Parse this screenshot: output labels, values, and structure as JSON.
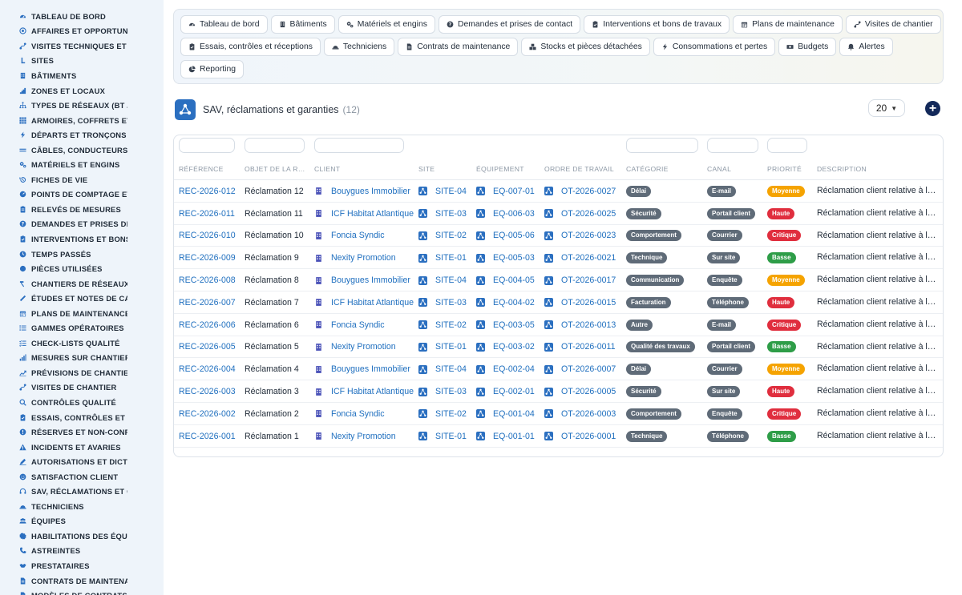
{
  "sidebar": {
    "items": [
      {
        "label": "TABLEAU DE BORD",
        "icon": "dashboard-icon"
      },
      {
        "label": "AFFAIRES ET OPPORTUNITÉS",
        "icon": "target-icon"
      },
      {
        "label": "VISITES TECHNIQUES ET DIAGNOSTICS",
        "icon": "route-icon"
      },
      {
        "label": "SITES",
        "icon": "pin-icon"
      },
      {
        "label": "BÂTIMENTS",
        "icon": "building-icon"
      },
      {
        "label": "ZONES ET LOCAUX",
        "icon": "stairs-icon"
      },
      {
        "label": "TYPES DE RÉSEAUX (BT / HTA)",
        "icon": "network-icon"
      },
      {
        "label": "ARMOIRES, COFFRETS ET TABLEAUX",
        "icon": "grid-icon"
      },
      {
        "label": "DÉPARTS ET TRONÇONS",
        "icon": "bolt-icon"
      },
      {
        "label": "CÂBLES, CONDUCTEURS",
        "icon": "lines-icon"
      },
      {
        "label": "MATÉRIELS ET ENGINS",
        "icon": "cogs-icon"
      },
      {
        "label": "FICHES DE VIE",
        "icon": "history-icon"
      },
      {
        "label": "POINTS DE COMPTAGE ET MESURE",
        "icon": "gauge-icon"
      },
      {
        "label": "RELEVÉS DE MESURES",
        "icon": "clipboard-icon"
      },
      {
        "label": "DEMANDES ET PRISES DE CONTACT",
        "icon": "help-icon"
      },
      {
        "label": "INTERVENTIONS ET BONS DE TRAVAUX",
        "icon": "clipboard-check-icon"
      },
      {
        "label": "TEMPS PASSÉS",
        "icon": "clock-icon"
      },
      {
        "label": "PIÈCES UTILISÉES",
        "icon": "dot-icon"
      },
      {
        "label": "CHANTIERS DE RÉSEAUX",
        "icon": "hammer-icon"
      },
      {
        "label": "ÉTUDES ET NOTES DE CALCUL",
        "icon": "ruler-icon"
      },
      {
        "label": "PLANS DE MAINTENANCE",
        "icon": "calendar-icon"
      },
      {
        "label": "GAMMES OPÉRATOIRES",
        "icon": "list-icon"
      },
      {
        "label": "CHECK-LISTS QUALITÉ",
        "icon": "checklist-icon"
      },
      {
        "label": "MESURES SUR CHANTIER",
        "icon": "signal-icon"
      },
      {
        "label": "PRÉVISIONS DE CHANTIER",
        "icon": "trend-icon"
      },
      {
        "label": "VISITES DE CHANTIER",
        "icon": "route-icon"
      },
      {
        "label": "CONTRÔLES QUALITÉ",
        "icon": "search-icon"
      },
      {
        "label": "ESSAIS, CONTRÔLES ET RÉCEPTIONS",
        "icon": "clipboard-check-icon"
      },
      {
        "label": "RÉSERVES ET NON-CONFORMITÉS",
        "icon": "alert-icon"
      },
      {
        "label": "INCIDENTS ET AVARIES",
        "icon": "warning-icon"
      },
      {
        "label": "AUTORISATIONS ET DICT",
        "icon": "sign-icon"
      },
      {
        "label": "SATISFACTION CLIENT",
        "icon": "smile-icon"
      },
      {
        "label": "SAV, RÉCLAMATIONS ET GARANTIES",
        "icon": "headset-icon"
      },
      {
        "label": "TECHNICIENS",
        "icon": "helmet-icon"
      },
      {
        "label": "ÉQUIPES",
        "icon": "users-icon"
      },
      {
        "label": "HABILITATIONS DES ÉQUIPES",
        "icon": "badge-icon"
      },
      {
        "label": "ASTREINTES",
        "icon": "phone-icon"
      },
      {
        "label": "PRESTATAIRES",
        "icon": "handshake-icon"
      },
      {
        "label": "CONTRATS DE MAINTENANCE",
        "icon": "file-icon"
      },
      {
        "label": "MODÈLES DE CONTRATS",
        "icon": "file-icon"
      }
    ]
  },
  "nav": {
    "rows": [
      [
        {
          "label": "Tableau de bord",
          "icon": "dashboard-icon"
        },
        {
          "label": "Bâtiments",
          "icon": "building-icon"
        },
        {
          "label": "Matériels et engins",
          "icon": "cogs-icon"
        },
        {
          "label": "Demandes et prises de contact",
          "icon": "help-icon"
        },
        {
          "label": "Interventions et bons de travaux",
          "icon": "clipboard-check-icon"
        },
        {
          "label": "Plans de maintenance",
          "icon": "calendar-icon"
        },
        {
          "label": "Visites de chantier",
          "icon": "route-icon"
        }
      ],
      [
        {
          "label": "Essais, contrôles et réceptions",
          "icon": "clipboard-check-icon"
        },
        {
          "label": "Techniciens",
          "icon": "helmet-icon"
        },
        {
          "label": "Contrats de maintenance",
          "icon": "file-icon"
        },
        {
          "label": "Stocks et pièces détachées",
          "icon": "boxes-icon"
        },
        {
          "label": "Consommations et pertes",
          "icon": "bolt-icon"
        },
        {
          "label": "Budgets",
          "icon": "money-icon"
        },
        {
          "label": "Alertes",
          "icon": "bell-icon"
        }
      ],
      [
        {
          "label": "Reporting",
          "icon": "chart-pie-icon"
        }
      ]
    ]
  },
  "header": {
    "title": "SAV, réclamations et garanties",
    "count": "(12)",
    "per_page": "20",
    "add_icon": "plus-icon"
  },
  "table": {
    "columns": [
      "RÉFÉRENCE",
      "OBJET DE LA R…",
      "CLIENT",
      "SITE",
      "ÉQUIPEMENT",
      "ORDRE DE TRAVAIL",
      "CATÉGORIE",
      "CANAL",
      "PRIORITÉ",
      "DESCRIPTION"
    ],
    "rows": [
      {
        "ref": "REC-2026-012",
        "objet": "Réclamation 12",
        "client": "Bouygues Immobilier",
        "site": "SITE-04",
        "equip": "EQ-007-01",
        "ot": "OT-2026-0027",
        "cat": "Délai",
        "canal": "E-mail",
        "prio": "Moyenne",
        "desc": "Réclamation client relative à l…"
      },
      {
        "ref": "REC-2026-011",
        "objet": "Réclamation 11",
        "client": "ICF Habitat Atlantique",
        "site": "SITE-03",
        "equip": "EQ-006-03",
        "ot": "OT-2026-0025",
        "cat": "Sécurité",
        "canal": "Portail client",
        "prio": "Haute",
        "desc": "Réclamation client relative à l…"
      },
      {
        "ref": "REC-2026-010",
        "objet": "Réclamation 10",
        "client": "Foncia Syndic",
        "site": "SITE-02",
        "equip": "EQ-005-06",
        "ot": "OT-2026-0023",
        "cat": "Comportement",
        "canal": "Courrier",
        "prio": "Critique",
        "desc": "Réclamation client relative à l…"
      },
      {
        "ref": "REC-2026-009",
        "objet": "Réclamation 9",
        "client": "Nexity Promotion",
        "site": "SITE-01",
        "equip": "EQ-005-03",
        "ot": "OT-2026-0021",
        "cat": "Technique",
        "canal": "Sur site",
        "prio": "Basse",
        "desc": "Réclamation client relative à l…"
      },
      {
        "ref": "REC-2026-008",
        "objet": "Réclamation 8",
        "client": "Bouygues Immobilier",
        "site": "SITE-04",
        "equip": "EQ-004-05",
        "ot": "OT-2026-0017",
        "cat": "Communication",
        "canal": "Enquête",
        "prio": "Moyenne",
        "desc": "Réclamation client relative à l…"
      },
      {
        "ref": "REC-2026-007",
        "objet": "Réclamation 7",
        "client": "ICF Habitat Atlantique",
        "site": "SITE-03",
        "equip": "EQ-004-02",
        "ot": "OT-2026-0015",
        "cat": "Facturation",
        "canal": "Téléphone",
        "prio": "Haute",
        "desc": "Réclamation client relative à l…"
      },
      {
        "ref": "REC-2026-006",
        "objet": "Réclamation 6",
        "client": "Foncia Syndic",
        "site": "SITE-02",
        "equip": "EQ-003-05",
        "ot": "OT-2026-0013",
        "cat": "Autre",
        "canal": "E-mail",
        "prio": "Critique",
        "desc": "Réclamation client relative à l…"
      },
      {
        "ref": "REC-2026-005",
        "objet": "Réclamation 5",
        "client": "Nexity Promotion",
        "site": "SITE-01",
        "equip": "EQ-003-02",
        "ot": "OT-2026-0011",
        "cat": "Qualité des travaux",
        "canal": "Portail client",
        "prio": "Basse",
        "desc": "Réclamation client relative à l…"
      },
      {
        "ref": "REC-2026-004",
        "objet": "Réclamation 4",
        "client": "Bouygues Immobilier",
        "site": "SITE-04",
        "equip": "EQ-002-04",
        "ot": "OT-2026-0007",
        "cat": "Délai",
        "canal": "Courrier",
        "prio": "Moyenne",
        "desc": "Réclamation client relative à l…"
      },
      {
        "ref": "REC-2026-003",
        "objet": "Réclamation 3",
        "client": "ICF Habitat Atlantique",
        "site": "SITE-03",
        "equip": "EQ-002-01",
        "ot": "OT-2026-0005",
        "cat": "Sécurité",
        "canal": "Sur site",
        "prio": "Haute",
        "desc": "Réclamation client relative à l…"
      },
      {
        "ref": "REC-2026-002",
        "objet": "Réclamation 2",
        "client": "Foncia Syndic",
        "site": "SITE-02",
        "equip": "EQ-001-04",
        "ot": "OT-2026-0003",
        "cat": "Comportement",
        "canal": "Enquête",
        "prio": "Critique",
        "desc": "Réclamation client relative à l…"
      },
      {
        "ref": "REC-2026-001",
        "objet": "Réclamation 1",
        "client": "Nexity Promotion",
        "site": "SITE-01",
        "equip": "EQ-001-01",
        "ot": "OT-2026-0001",
        "cat": "Technique",
        "canal": "Téléphone",
        "prio": "Basse",
        "desc": "Réclamation client relative à l…"
      }
    ]
  },
  "colors": {
    "accent": "#1f6fbf",
    "moyenne": "#f5a300",
    "haute": "#e02e3e",
    "critique": "#e02e3e",
    "basse": "#2e9d48",
    "neutral_badge": "#5f6b78",
    "add_button": "#13295a"
  }
}
